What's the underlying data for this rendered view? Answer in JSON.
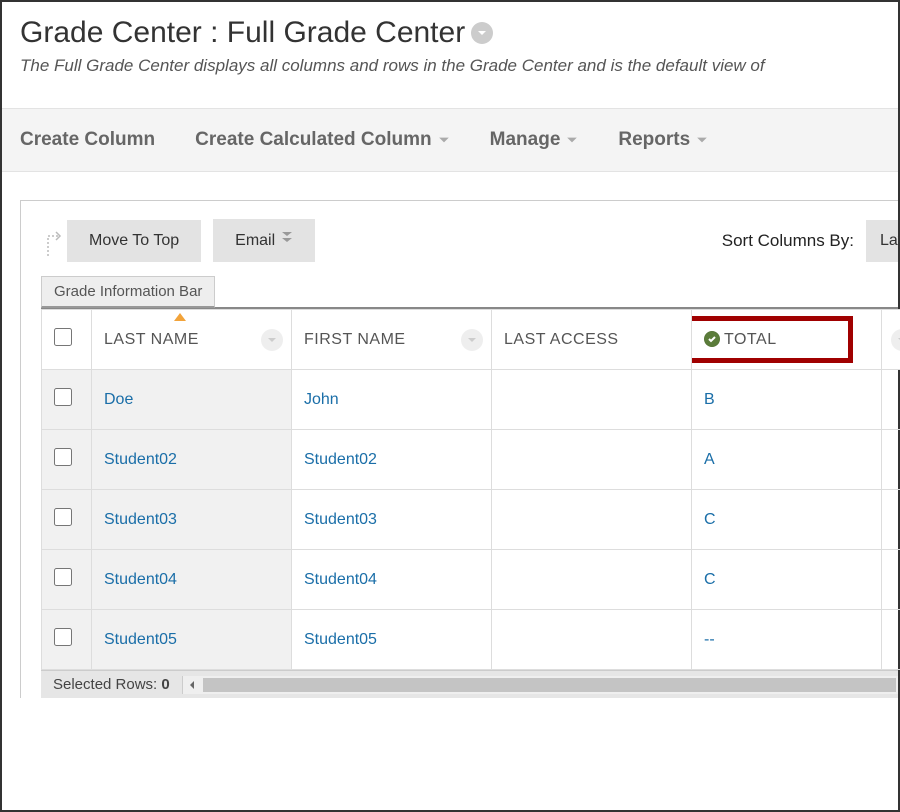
{
  "header": {
    "title": "Grade Center : Full Grade Center",
    "description": "The Full Grade Center displays all columns and rows in the Grade Center and is the default view of"
  },
  "actionbar": {
    "create_column": "Create Column",
    "create_calculated_column": "Create Calculated Column",
    "manage": "Manage",
    "reports": "Reports"
  },
  "grid_toolbar": {
    "move_to_top": "Move To Top",
    "email": "Email",
    "sort_columns_by": "Sort Columns By:",
    "layout_order": "Lay"
  },
  "grade_info_bar": "Grade Information Bar",
  "columns": {
    "last_name": "LAST NAME",
    "first_name": "FIRST NAME",
    "last_access": "LAST ACCESS",
    "total": "TOTAL"
  },
  "rows": [
    {
      "last_name": "Doe",
      "first_name": "John",
      "last_access": "",
      "total": "B"
    },
    {
      "last_name": "Student02",
      "first_name": "Student02",
      "last_access": "",
      "total": "A"
    },
    {
      "last_name": "Student03",
      "first_name": "Student03",
      "last_access": "",
      "total": "C"
    },
    {
      "last_name": "Student04",
      "first_name": "Student04",
      "last_access": "",
      "total": "C"
    },
    {
      "last_name": "Student05",
      "first_name": "Student05",
      "last_access": "",
      "total": "--"
    }
  ],
  "footer": {
    "selected_rows_label": "Selected Rows:",
    "selected_rows_count": "0"
  }
}
